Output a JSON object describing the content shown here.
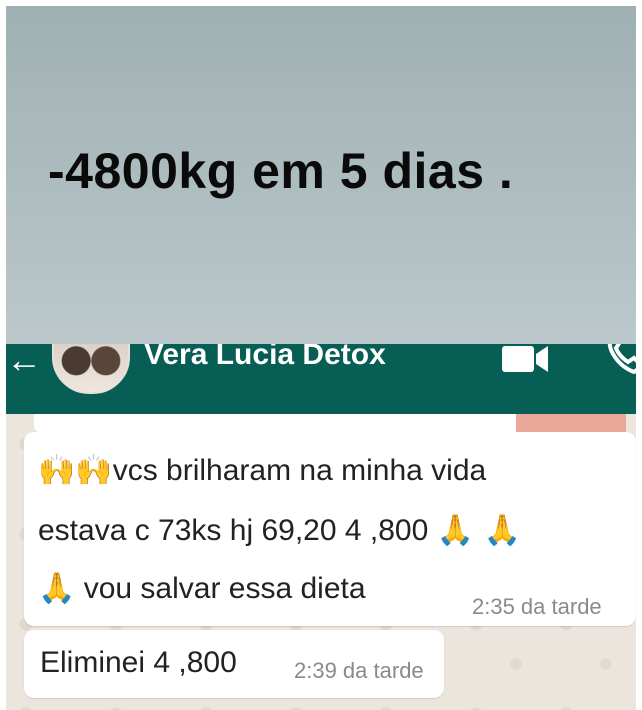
{
  "banner": {
    "headline": "-4800kg em 5 dias ."
  },
  "chat_header": {
    "back_icon": "back-arrow-icon",
    "contact_name": "Vera Lucia Detox",
    "video_icon": "video-call-icon",
    "phone_icon": "phone-call-icon"
  },
  "messages": [
    {
      "line1_emoji": "🙌🙌",
      "line1_text": "vcs  brilharam  na minha  vida",
      "line2_text": "estava  c 73ks hj 69,20  4 ,800",
      "line2_emoji": "🙏 🙏",
      "line3_emoji": "🙏",
      "line3_text": "vou salvar essa dieta",
      "time": "2:35 da tarde"
    },
    {
      "text": "Eliminei 4 ,800",
      "time": "2:39 da tarde"
    }
  ],
  "colors": {
    "header_bg": "#075e54",
    "chat_bg": "#ece5dd",
    "bubble_bg": "#ffffff",
    "banner_bg": "#aebdc0"
  }
}
